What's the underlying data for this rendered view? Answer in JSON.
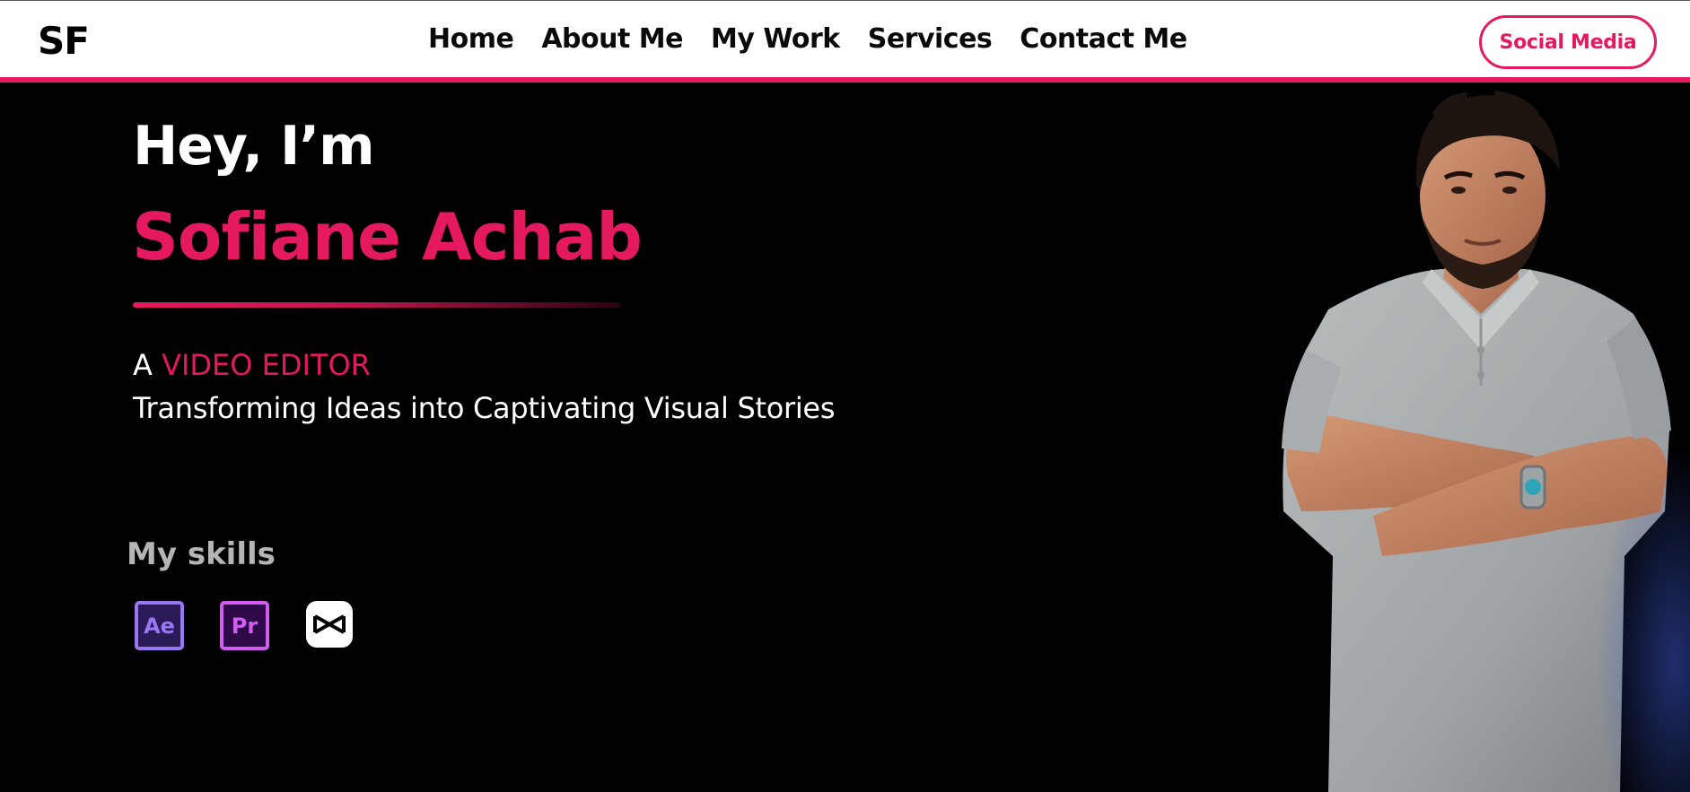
{
  "header": {
    "logo": "SF",
    "nav": [
      "Home",
      "About Me",
      "My Work",
      "Services",
      "Contact Me"
    ],
    "social_label": "Social Media"
  },
  "hero": {
    "greeting": "Hey, I’m",
    "name": "Sofiane Achab",
    "role_prefix": "A",
    "role": "VIDEO EDITOR",
    "tagline": "Transforming Ideas into Captivating Visual Stories"
  },
  "skills": {
    "title": "My skills",
    "items": [
      {
        "label": "Ae",
        "icon": "after-effects-icon"
      },
      {
        "label": "Pr",
        "icon": "premiere-pro-icon"
      },
      {
        "icon": "capcut-icon"
      }
    ]
  },
  "portrait": {
    "icon": "person-portrait"
  },
  "colors": {
    "accent": "#e5195f",
    "background": "#000000",
    "header_bg": "#ffffff"
  }
}
